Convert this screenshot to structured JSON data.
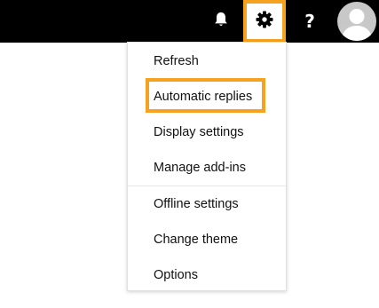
{
  "topbar": {
    "background": "#000000",
    "notifications": {
      "icon": "bell-icon"
    },
    "settings": {
      "icon": "gear-icon",
      "highlighted": true
    },
    "help": {
      "icon": "help-icon",
      "glyph": "?"
    },
    "account": {
      "icon": "avatar-icon"
    }
  },
  "settings_menu": {
    "items": [
      {
        "label": "Refresh"
      },
      {
        "label": "Automatic replies",
        "highlighted": true
      },
      {
        "label": "Display settings"
      },
      {
        "label": "Manage add-ins"
      },
      {
        "label": "Offline settings"
      },
      {
        "label": "Change theme"
      },
      {
        "label": "Options"
      }
    ]
  },
  "colors": {
    "highlight": "#f7a21e",
    "text": "#111111"
  }
}
